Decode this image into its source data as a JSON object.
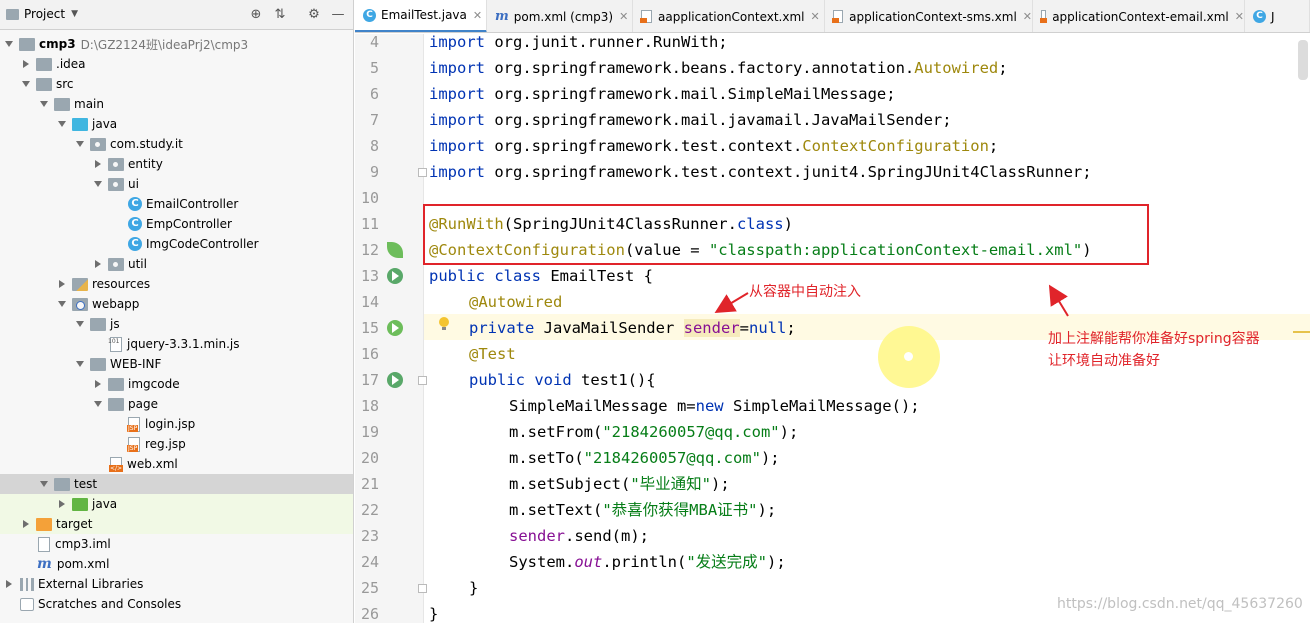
{
  "project_panel": {
    "title": "Project",
    "tree": [
      {
        "label": "cmp3",
        "suffix": "D:\\GZ2124班\\ideaPrj2\\cmp3",
        "icon": "folder-icon",
        "state": "open"
      },
      {
        "label": ".idea",
        "icon": "folder-icon",
        "state": "closed"
      },
      {
        "label": "src",
        "icon": "folder-icon",
        "state": "open"
      },
      {
        "label": "main",
        "icon": "folder-icon",
        "state": "open"
      },
      {
        "label": "java",
        "icon": "source-folder-icon",
        "state": "open"
      },
      {
        "label": "com.study.it",
        "icon": "package-icon",
        "state": "open"
      },
      {
        "label": "entity",
        "icon": "package-icon",
        "state": "closed"
      },
      {
        "label": "ui",
        "icon": "package-icon",
        "state": "open"
      },
      {
        "label": "EmailController",
        "icon": "java-class-icon"
      },
      {
        "label": "EmpController",
        "icon": "java-class-icon"
      },
      {
        "label": "ImgCodeController",
        "icon": "java-class-icon"
      },
      {
        "label": "util",
        "icon": "package-icon",
        "state": "closed"
      },
      {
        "label": "resources",
        "icon": "resources-folder-icon",
        "state": "closed"
      },
      {
        "label": "webapp",
        "icon": "web-folder-icon",
        "state": "open"
      },
      {
        "label": "js",
        "icon": "folder-icon",
        "state": "open"
      },
      {
        "label": "jquery-3.3.1.min.js",
        "icon": "js-file-icon"
      },
      {
        "label": "WEB-INF",
        "icon": "folder-icon",
        "state": "open"
      },
      {
        "label": "imgcode",
        "icon": "folder-icon",
        "state": "closed"
      },
      {
        "label": "page",
        "icon": "folder-icon",
        "state": "open"
      },
      {
        "label": "login.jsp",
        "icon": "jsp-file-icon"
      },
      {
        "label": "reg.jsp",
        "icon": "jsp-file-icon"
      },
      {
        "label": "web.xml",
        "icon": "xml-file-icon"
      },
      {
        "label": "test",
        "icon": "folder-icon",
        "state": "open"
      },
      {
        "label": "java",
        "icon": "test-folder-icon",
        "state": "closed"
      },
      {
        "label": "target",
        "icon": "excluded-folder-icon",
        "state": "closed"
      },
      {
        "label": "cmp3.iml",
        "icon": "iml-file-icon"
      },
      {
        "label": "pom.xml",
        "icon": "maven-icon"
      },
      {
        "label": "External Libraries",
        "icon": "library-icon",
        "state": "closed"
      },
      {
        "label": "Scratches and Consoles",
        "icon": "scratch-icon",
        "state": "closed"
      }
    ]
  },
  "tabs": [
    {
      "label": "EmailTest.java",
      "icon": "java-class-icon",
      "active": true
    },
    {
      "label": "pom.xml (cmp3)",
      "icon": "maven-icon",
      "active": false
    },
    {
      "label": "aapplicationContext.xml",
      "icon": "xml-file-icon",
      "active": false
    },
    {
      "label": "applicationContext-sms.xml",
      "icon": "xml-file-icon",
      "active": false
    },
    {
      "label": "applicationContext-email.xml",
      "icon": "xml-file-icon",
      "active": false
    },
    {
      "label": "J",
      "icon": "java-class-icon",
      "active": false
    }
  ],
  "editor": {
    "line_numbers": [
      "4",
      "5",
      "6",
      "7",
      "8",
      "9",
      "10",
      "11",
      "12",
      "13",
      "14",
      "15",
      "16",
      "17",
      "18",
      "19",
      "20",
      "21",
      "22",
      "23",
      "24",
      "25",
      "26"
    ],
    "code": {
      "l4_kw": "import",
      "l4_rest": " org.junit.runner.RunWith;",
      "l5_kw": "import",
      "l5_rest": " org.springframework.beans.factory.annotation.",
      "l5_ann": "Autowired",
      "l5_end": ";",
      "l6_kw": "import",
      "l6_rest": " org.springframework.mail.SimpleMailMessage;",
      "l7_kw": "import",
      "l7_rest": " org.springframework.mail.javamail.JavaMailSender;",
      "l8_kw": "import",
      "l8_rest": " org.springframework.test.context.",
      "l8_ann": "ContextConfiguration",
      "l8_end": ";",
      "l9_kw": "import",
      "l9_rest": " org.springframework.test.context.junit4.SpringJUnit4ClassRunner;",
      "l11_ann": "@RunWith",
      "l11_rest": "(SpringJUnit4ClassRunner.",
      "l11_kw": "class",
      "l11_end": ")",
      "l12_ann": "@ContextConfiguration",
      "l12_rest": "(value = ",
      "l12_str": "\"classpath:applicationContext-email.xml\"",
      "l12_end": ")",
      "l13_kw": "public class",
      "l13_rest": " EmailTest {",
      "l14_ann": "@Autowired",
      "l15_kw": "private",
      "l15_rest": " JavaMailSender ",
      "l15_var": "sender",
      "l15_eq": "=",
      "l15_kw2": "null",
      "l15_end": ";",
      "l16_ann": "@Test",
      "l17_kw": "public void",
      "l17_rest": " test1(){",
      "l18_a": "SimpleMailMessage m=",
      "l18_kw": "new",
      "l18_b": " SimpleMailMessage();",
      "l19_a": "m.setFrom(",
      "l19_str": "\"2184260057@qq.com\"",
      "l19_b": ");",
      "l20_a": "m.setTo(",
      "l20_str": "\"2184260057@qq.com\"",
      "l20_b": ");",
      "l21_a": "m.setSubject(",
      "l21_str": "\"毕业通知\"",
      "l21_b": ");",
      "l22_a": "m.setText(",
      "l22_str": "\"恭喜你获得MBA证书\"",
      "l22_b": ");",
      "l23_fld": "sender",
      "l23_b": ".send(m);",
      "l24_a": "System.",
      "l24_stat": "out",
      "l24_b": ".println(",
      "l24_str": "\"发送完成\"",
      "l24_c": ");",
      "l25": "}",
      "l26": "}"
    }
  },
  "annotations": {
    "inject_note": "从容器中自动注入",
    "container_note_1": "加上注解能帮你准备好spring容器",
    "container_note_2": "让环境自动准备好"
  },
  "watermark": "https://blog.csdn.net/qq_45637260",
  "colors": {
    "keyword": "#0033b3",
    "annotation": "#9e880d",
    "string": "#067d17",
    "field": "#871094",
    "annotation_red": "#e0242a",
    "selection": "#d5d5d5"
  }
}
